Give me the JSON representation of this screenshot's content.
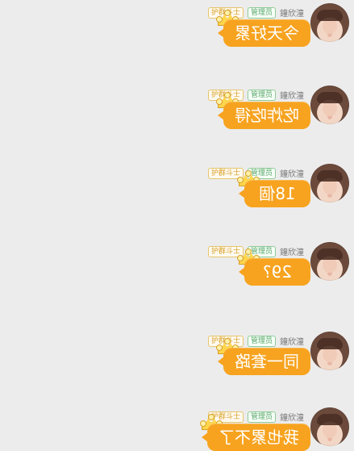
{
  "user": {
    "name": "鐘欣潼",
    "admin_badge": "管理员",
    "rank_badge": "护群斗士"
  },
  "messages": [
    {
      "text": "今天好累"
    },
    {
      "text": "吃炸吃得"
    },
    {
      "text": "18個"
    },
    {
      "text": "29?"
    },
    {
      "text": "同一套路"
    },
    {
      "text": "我也累不了"
    }
  ],
  "colors": {
    "background": "#ececec",
    "bubble": "#f7a31f",
    "bubble_text": "#ffffff",
    "admin_badge": "#5aa66b",
    "rank_badge": "#d8a12a"
  },
  "icons": {
    "avatar": "user-avatar",
    "crown": "crown-icon"
  }
}
